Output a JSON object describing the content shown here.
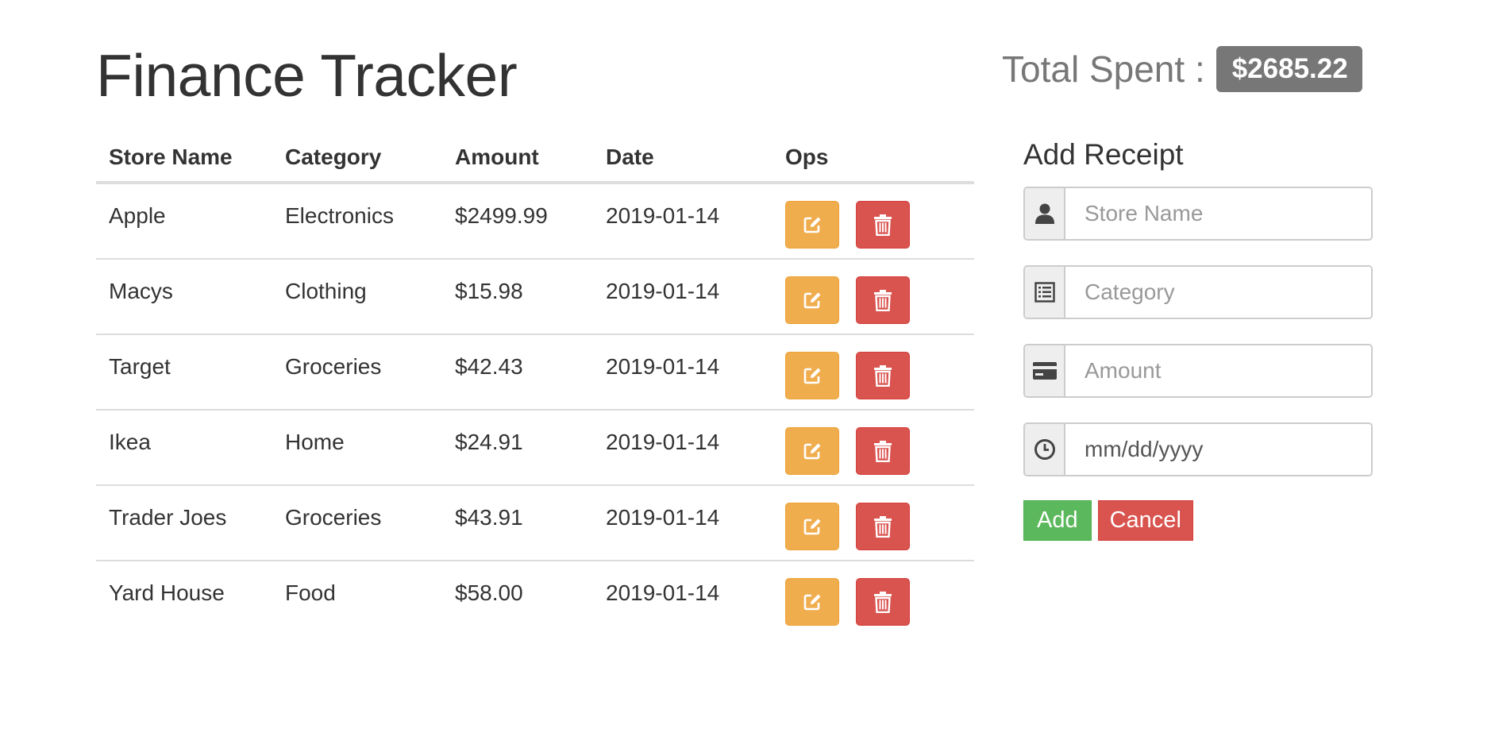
{
  "header": {
    "title": "Finance Tracker",
    "total_label": "Total Spent :",
    "total_value": "$2685.22"
  },
  "table": {
    "columns": [
      "Store Name",
      "Category",
      "Amount",
      "Date",
      "Ops"
    ],
    "rows": [
      {
        "store": "Apple",
        "category": "Electronics",
        "amount": "$2499.99",
        "date": "2019-01-14"
      },
      {
        "store": "Macys",
        "category": "Clothing",
        "amount": "$15.98",
        "date": "2019-01-14"
      },
      {
        "store": "Target",
        "category": "Groceries",
        "amount": "$42.43",
        "date": "2019-01-14"
      },
      {
        "store": "Ikea",
        "category": "Home",
        "amount": "$24.91",
        "date": "2019-01-14"
      },
      {
        "store": "Trader Joes",
        "category": "Groceries",
        "amount": "$43.91",
        "date": "2019-01-14"
      },
      {
        "store": "Yard House",
        "category": "Food",
        "amount": "$58.00",
        "date": "2019-01-14"
      }
    ],
    "edit_icon": "edit-icon",
    "delete_icon": "trash-icon"
  },
  "form": {
    "title": "Add Receipt",
    "fields": [
      {
        "icon": "user-icon",
        "placeholder": "Store Name",
        "value": ""
      },
      {
        "icon": "list-icon",
        "placeholder": "Category",
        "value": ""
      },
      {
        "icon": "credit-card-icon",
        "placeholder": "Amount",
        "value": ""
      },
      {
        "icon": "clock-icon",
        "placeholder": "mm/dd/yyyy",
        "value": ""
      }
    ],
    "add_label": "Add",
    "cancel_label": "Cancel"
  },
  "colors": {
    "badge": "#777777",
    "edit_button": "#f0ad4e",
    "delete_button": "#d9534f",
    "add_button": "#5cb85c",
    "cancel_button": "#d9534f"
  }
}
